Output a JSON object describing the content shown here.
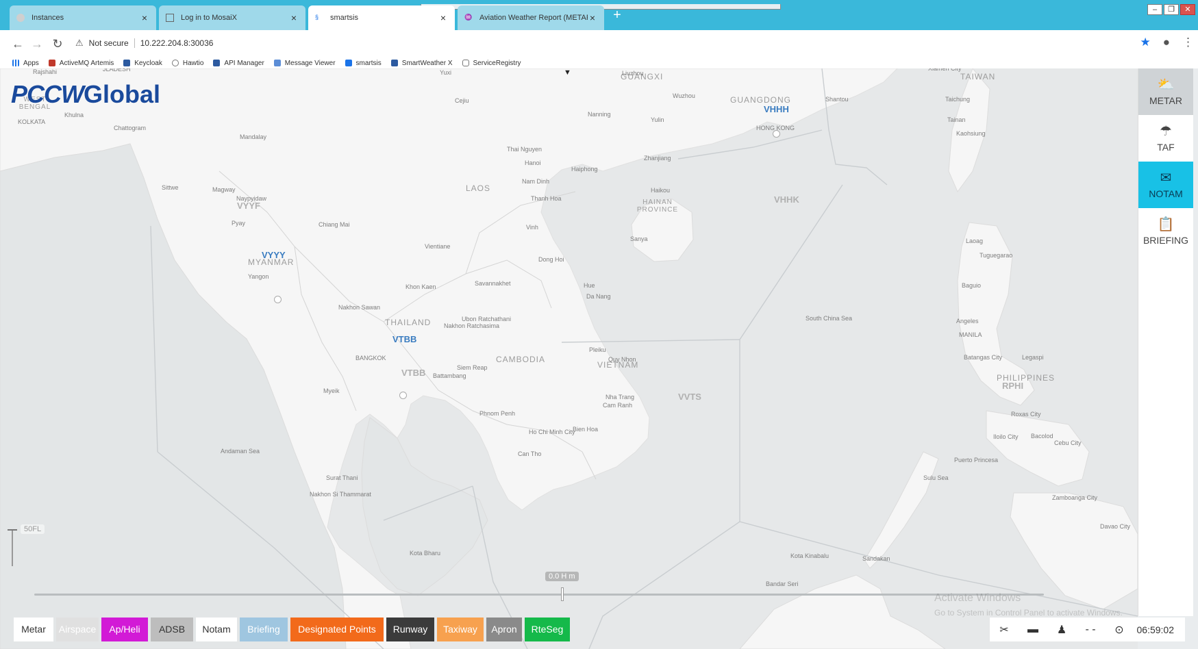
{
  "browser": {
    "tabs": [
      {
        "title": "Instances",
        "active": false
      },
      {
        "title": "Log in to MosaiX",
        "active": false
      },
      {
        "title": "smartsis",
        "active": true
      },
      {
        "title": "Aviation Weather Report (METAR",
        "active": false
      }
    ],
    "new_tab": "+",
    "window_controls": {
      "minimize": "–",
      "restore": "❐",
      "close": "✕"
    },
    "nav": {
      "back": "←",
      "forward": "→",
      "reload": "↻"
    },
    "security_label": "Not secure",
    "url": "10.222.204.8:30036",
    "bookmarks": [
      "Apps",
      "ActiveMQ Artemis",
      "Keycloak",
      "Hawtio",
      "API Manager",
      "Message Viewer",
      "smartsis",
      "SmartWeather X",
      "ServiceRegistry"
    ]
  },
  "app": {
    "logo_prefix": "PCCW",
    "logo_suffix": "Global",
    "right_panel": [
      {
        "label": "METAR",
        "icon": "cloud-sun-icon",
        "glyph": "⛅",
        "state": "selected"
      },
      {
        "label": "TAF",
        "icon": "cloud-rain-icon",
        "glyph": "☂",
        "state": "normal"
      },
      {
        "label": "NOTAM",
        "icon": "message-icon",
        "glyph": "✉",
        "state": "active"
      },
      {
        "label": "BRIEFING",
        "icon": "clipboard-icon",
        "glyph": "📋",
        "state": "normal"
      }
    ],
    "filters": [
      {
        "label": "Metar",
        "bg": "#ffffff",
        "fg": "#333333"
      },
      {
        "label": "Airspace",
        "bg": "#e0e0e0",
        "fg": "#ffffff"
      },
      {
        "label": "Ap/Heli",
        "bg": "#d21ad6",
        "fg": "#ffffff"
      },
      {
        "label": "ADSB",
        "bg": "#bdbdbd",
        "fg": "#333333"
      },
      {
        "label": "Notam",
        "bg": "#ffffff",
        "fg": "#333333"
      },
      {
        "label": "Briefing",
        "bg": "#9fc6e0",
        "fg": "#ffffff"
      },
      {
        "label": "Designated Points",
        "bg": "#f26a1b",
        "fg": "#ffffff"
      },
      {
        "label": "Runway",
        "bg": "#3b3b3b",
        "fg": "#ffffff"
      },
      {
        "label": "Taxiway",
        "bg": "#f7a14f",
        "fg": "#ffffff"
      },
      {
        "label": "Apron",
        "bg": "#8a8a8a",
        "fg": "#ffffff"
      },
      {
        "label": "RteSeg",
        "bg": "#15b94a",
        "fg": "#ffffff"
      }
    ],
    "tools": {
      "tool1": "✂",
      "tool2": "▬",
      "tool3": "♟",
      "tool4": "- -",
      "tool5": "⊙"
    },
    "clock": "06:59:02",
    "flight_level": "50FL",
    "time_offset": "0.0 H m",
    "watermark_title": "Activate Windows",
    "watermark_sub": "Go to System in Control Panel to activate Windows."
  },
  "map": {
    "countries": [
      {
        "text": "LAOS"
      },
      {
        "text": "THAILAND"
      },
      {
        "text": "CAMBODIA"
      },
      {
        "text": "VIETNAM"
      },
      {
        "text": "MYANMAR"
      },
      {
        "text": "HAINAN PROVINCE"
      },
      {
        "text": "GUANGDONG"
      },
      {
        "text": "GUANGXI"
      },
      {
        "text": "TAIWAN"
      },
      {
        "text": "PHILIPPINES"
      },
      {
        "text": "WEST BENGAL"
      }
    ],
    "firs": [
      {
        "text": "VHHH",
        "blue": true
      },
      {
        "text": "VHHK",
        "blue": false
      },
      {
        "text": "VYYF",
        "blue": false
      },
      {
        "text": "VYYY",
        "blue": true
      },
      {
        "text": "VTBB",
        "blue": true
      },
      {
        "text": "VTBB",
        "blue": false
      },
      {
        "text": "VVTS",
        "blue": false
      },
      {
        "text": "RPHI",
        "blue": false
      }
    ],
    "cities": [
      "Rajshahi",
      "JLADESH",
      "Yuxi",
      "Liuzhou",
      "Wuzhou",
      "Shantou",
      "Xiamen City",
      "Cejiu",
      "Nanning",
      "Yulin",
      "HONG KONG",
      "Taichung",
      "Tainan",
      "Kaohsiung",
      "Khulna",
      "Chattogram",
      "Mandalay",
      "KOLKATA",
      "Thai Nguyen",
      "Hanoi",
      "Haiphong",
      "Zhanjiang",
      "Nam Dinh",
      "Thanh Hoa",
      "Haikou",
      "Sittwe",
      "Magway",
      "Naypyidaw",
      "Pyay",
      "Chiang Mai",
      "Vinh",
      "Sanya",
      "Vientiane",
      "Dong Hoi",
      "Yangon",
      "Khon Kaen",
      "Savannakhet",
      "Hue",
      "Da Nang",
      "Nakhon Sawan",
      "Ubon Ratchathani",
      "Nakhon Ratchasima",
      "BANGKOK",
      "Siem Reap",
      "Battambang",
      "Pleiku",
      "Quy Nhon",
      "Nha Trang",
      "Cam Ranh",
      "Phnom Penh",
      "Ho Chi Minh City",
      "Bien Hoa",
      "Can Tho",
      "Myeik",
      "Surat Thani",
      "Nakhon Si Thammarat",
      "Kota Bharu",
      "Andaman Sea",
      "South China Sea",
      "Sulu Sea",
      "Laoag",
      "Tuguegarao",
      "Baguio",
      "Angeles",
      "MANILA",
      "Batangas City",
      "Legaspi",
      "Roxas City",
      "Iloilo City",
      "Bacolod",
      "Cebu City",
      "Puerto Princesa",
      "Zamboanga City",
      "Davao City",
      "Sandakan",
      "Kota Kinabalu",
      "Bandar Seri"
    ]
  }
}
